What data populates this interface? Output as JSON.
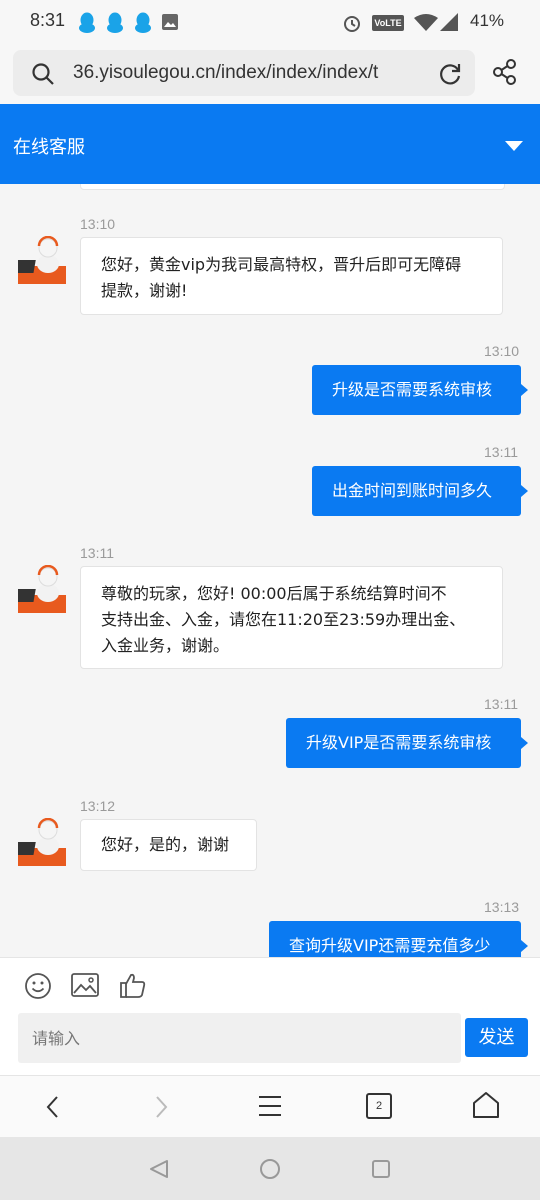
{
  "status_bar": {
    "time": "8:31",
    "battery": "41%",
    "volte": "VoLTE"
  },
  "address_bar": {
    "url": "36.yisoulegou.cn/index/index/index/t"
  },
  "header": {
    "title": "在线客服"
  },
  "messages": [
    {
      "side": "left",
      "time": "13:10",
      "lines": [
        "您好，黄金vip为我司最高特权，晋升后即可无障碍",
        "提款，谢谢!"
      ]
    },
    {
      "side": "right",
      "time": "13:10",
      "text": "升级是否需要系统审核"
    },
    {
      "side": "right",
      "time": "13:11",
      "text": "出金时间到账时间多久"
    },
    {
      "side": "left",
      "time": "13:11",
      "lines": [
        "尊敬的玩家，您好! 00:00后属于系统结算时间不",
        "支持出金、入金，请您在11:20至23:59办理出金、",
        "入金业务，谢谢。"
      ]
    },
    {
      "side": "right",
      "time": "13:11",
      "text": "升级VIP是否需要系统审核"
    },
    {
      "side": "left",
      "time": "13:12",
      "lines": [
        "您好，是的，谢谢"
      ]
    },
    {
      "side": "right",
      "time": "13:13",
      "text": "查询升级VIP还需要充值多少"
    }
  ],
  "composer": {
    "placeholder": "请输入",
    "send_label": "发送"
  },
  "browser_nav": {
    "tab_count": "2"
  },
  "colors": {
    "accent": "#0a7af2"
  }
}
